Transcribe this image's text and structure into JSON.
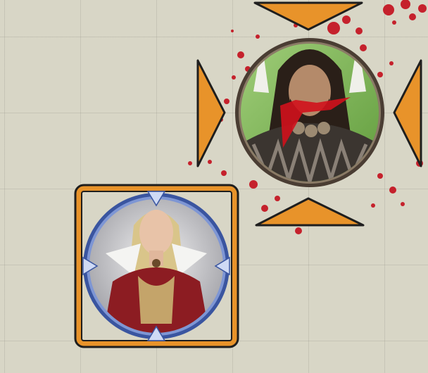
{
  "map": {
    "grid": true,
    "colors": {
      "background": "#d8d6c6",
      "gridline": "#b9b8aa",
      "blood": "#c4121f",
      "move_arrow": "#e8932a",
      "move_arrow_outline": "#1e1e1e",
      "selection_frame": "#e8932a"
    }
  },
  "tokens": [
    {
      "id": "barbarian",
      "icon": "horned-barbarian-portrait-icon",
      "ring_color": "#4a3d33",
      "backdrop": "#8cbf5a",
      "state": "bloodied",
      "move_arrows": [
        "up",
        "down",
        "left",
        "right"
      ]
    },
    {
      "id": "noblewoman",
      "icon": "noblewoman-portrait-icon",
      "ring_color": "#4f6fb5",
      "backdrop": "#c7c7cb",
      "state": "selected"
    }
  ]
}
